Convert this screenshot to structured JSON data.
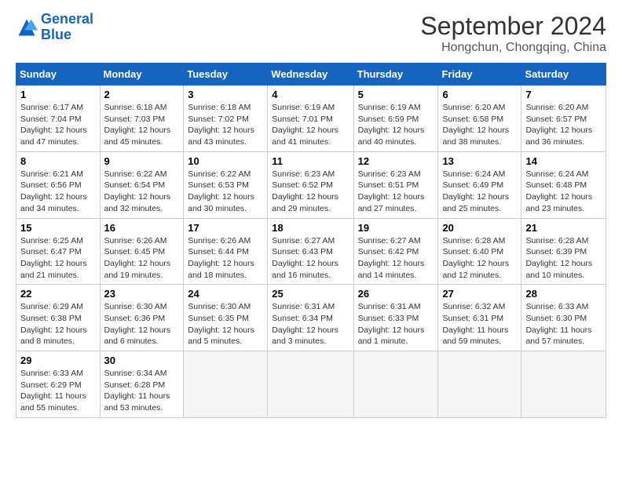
{
  "logo": {
    "line1": "General",
    "line2": "Blue"
  },
  "title": "September 2024",
  "subtitle": "Hongchun, Chongqing, China",
  "days_header": [
    "Sunday",
    "Monday",
    "Tuesday",
    "Wednesday",
    "Thursday",
    "Friday",
    "Saturday"
  ],
  "weeks": [
    [
      {
        "day": "1",
        "content": "Sunrise: 6:17 AM\nSunset: 7:04 PM\nDaylight: 12 hours and 47 minutes."
      },
      {
        "day": "2",
        "content": "Sunrise: 6:18 AM\nSunset: 7:03 PM\nDaylight: 12 hours and 45 minutes."
      },
      {
        "day": "3",
        "content": "Sunrise: 6:18 AM\nSunset: 7:02 PM\nDaylight: 12 hours and 43 minutes."
      },
      {
        "day": "4",
        "content": "Sunrise: 6:19 AM\nSunset: 7:01 PM\nDaylight: 12 hours and 41 minutes."
      },
      {
        "day": "5",
        "content": "Sunrise: 6:19 AM\nSunset: 6:59 PM\nDaylight: 12 hours and 40 minutes."
      },
      {
        "day": "6",
        "content": "Sunrise: 6:20 AM\nSunset: 6:58 PM\nDaylight: 12 hours and 38 minutes."
      },
      {
        "day": "7",
        "content": "Sunrise: 6:20 AM\nSunset: 6:57 PM\nDaylight: 12 hours and 36 minutes."
      }
    ],
    [
      {
        "day": "8",
        "content": "Sunrise: 6:21 AM\nSunset: 6:56 PM\nDaylight: 12 hours and 34 minutes."
      },
      {
        "day": "9",
        "content": "Sunrise: 6:22 AM\nSunset: 6:54 PM\nDaylight: 12 hours and 32 minutes."
      },
      {
        "day": "10",
        "content": "Sunrise: 6:22 AM\nSunset: 6:53 PM\nDaylight: 12 hours and 30 minutes."
      },
      {
        "day": "11",
        "content": "Sunrise: 6:23 AM\nSunset: 6:52 PM\nDaylight: 12 hours and 29 minutes."
      },
      {
        "day": "12",
        "content": "Sunrise: 6:23 AM\nSunset: 6:51 PM\nDaylight: 12 hours and 27 minutes."
      },
      {
        "day": "13",
        "content": "Sunrise: 6:24 AM\nSunset: 6:49 PM\nDaylight: 12 hours and 25 minutes."
      },
      {
        "day": "14",
        "content": "Sunrise: 6:24 AM\nSunset: 6:48 PM\nDaylight: 12 hours and 23 minutes."
      }
    ],
    [
      {
        "day": "15",
        "content": "Sunrise: 6:25 AM\nSunset: 6:47 PM\nDaylight: 12 hours and 21 minutes."
      },
      {
        "day": "16",
        "content": "Sunrise: 6:26 AM\nSunset: 6:45 PM\nDaylight: 12 hours and 19 minutes."
      },
      {
        "day": "17",
        "content": "Sunrise: 6:26 AM\nSunset: 6:44 PM\nDaylight: 12 hours and 18 minutes."
      },
      {
        "day": "18",
        "content": "Sunrise: 6:27 AM\nSunset: 6:43 PM\nDaylight: 12 hours and 16 minutes."
      },
      {
        "day": "19",
        "content": "Sunrise: 6:27 AM\nSunset: 6:42 PM\nDaylight: 12 hours and 14 minutes."
      },
      {
        "day": "20",
        "content": "Sunrise: 6:28 AM\nSunset: 6:40 PM\nDaylight: 12 hours and 12 minutes."
      },
      {
        "day": "21",
        "content": "Sunrise: 6:28 AM\nSunset: 6:39 PM\nDaylight: 12 hours and 10 minutes."
      }
    ],
    [
      {
        "day": "22",
        "content": "Sunrise: 6:29 AM\nSunset: 6:38 PM\nDaylight: 12 hours and 8 minutes."
      },
      {
        "day": "23",
        "content": "Sunrise: 6:30 AM\nSunset: 6:36 PM\nDaylight: 12 hours and 6 minutes."
      },
      {
        "day": "24",
        "content": "Sunrise: 6:30 AM\nSunset: 6:35 PM\nDaylight: 12 hours and 5 minutes."
      },
      {
        "day": "25",
        "content": "Sunrise: 6:31 AM\nSunset: 6:34 PM\nDaylight: 12 hours and 3 minutes."
      },
      {
        "day": "26",
        "content": "Sunrise: 6:31 AM\nSunset: 6:33 PM\nDaylight: 12 hours and 1 minute."
      },
      {
        "day": "27",
        "content": "Sunrise: 6:32 AM\nSunset: 6:31 PM\nDaylight: 11 hours and 59 minutes."
      },
      {
        "day": "28",
        "content": "Sunrise: 6:33 AM\nSunset: 6:30 PM\nDaylight: 11 hours and 57 minutes."
      }
    ],
    [
      {
        "day": "29",
        "content": "Sunrise: 6:33 AM\nSunset: 6:29 PM\nDaylight: 11 hours and 55 minutes."
      },
      {
        "day": "30",
        "content": "Sunrise: 6:34 AM\nSunset: 6:28 PM\nDaylight: 11 hours and 53 minutes."
      },
      {
        "day": "",
        "content": ""
      },
      {
        "day": "",
        "content": ""
      },
      {
        "day": "",
        "content": ""
      },
      {
        "day": "",
        "content": ""
      },
      {
        "day": "",
        "content": ""
      }
    ]
  ]
}
